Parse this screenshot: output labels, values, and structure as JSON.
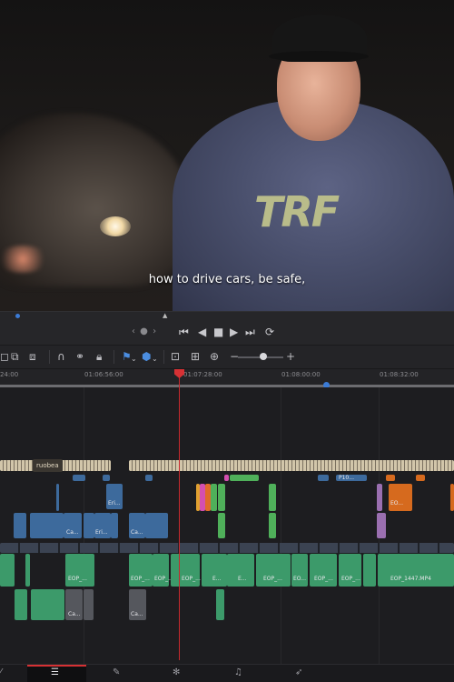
{
  "viewer": {
    "caption": "how to drive cars, be safe,",
    "hoodie_logo": "TRF"
  },
  "transport": {
    "position_icons": "‹ ● ›",
    "buttons": [
      "first-frame",
      "prev",
      "stop",
      "play",
      "last-frame",
      "loop"
    ]
  },
  "ruler": {
    "timecodes": [
      "24:00",
      "01:06:56:00",
      "01:07:28:00",
      "01:08:00:00",
      "01:08:32:00"
    ]
  },
  "tracks": {
    "subtitle_clip_label": "ruobea",
    "clip_labels": {
      "eri": "Eri...",
      "ca": "Ca...",
      "e": "E...",
      "p10": "P10...",
      "eop": "EOP_...",
      "eop_full": "EOP_1447.MP4",
      "eo": "EO..."
    }
  },
  "colors": {
    "playhead": "#c8292e",
    "video_clip": "#3d6a9c",
    "audio_clip": "#3c9a6a",
    "subtitle_clip": "#cfc3a8",
    "accent_blue": "#3b7bd6"
  },
  "pages": {
    "items": [
      "media",
      "edit",
      "fusion",
      "color",
      "fairlight",
      "deliver"
    ]
  }
}
